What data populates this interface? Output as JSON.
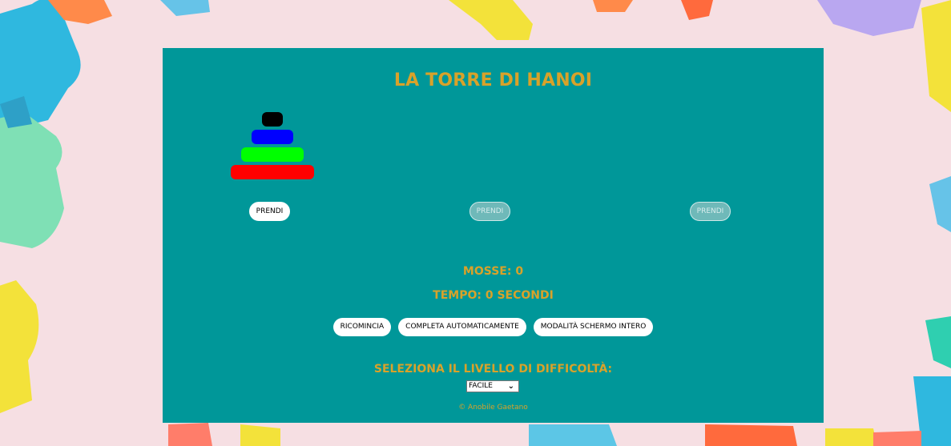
{
  "title": "LA TORRE DI HANOI",
  "towers": [
    {
      "take_label": "PRENDI",
      "enabled": true,
      "disks": [
        {
          "color": "#000000",
          "size": 1
        },
        {
          "color": "#0000ff",
          "size": 2
        },
        {
          "color": "#00ff00",
          "size": 3
        },
        {
          "color": "#ff0000",
          "size": 4
        }
      ]
    },
    {
      "take_label": "PRENDI",
      "enabled": false,
      "disks": []
    },
    {
      "take_label": "PRENDI",
      "enabled": false,
      "disks": []
    }
  ],
  "stats": {
    "moves_text": "MOSSE: 0",
    "time_text": "TEMPO: 0 SECONDI"
  },
  "actions": {
    "restart": "RICOMINCIA",
    "auto_complete": "COMPLETA AUTOMATICAMENTE",
    "fullscreen": "MODALITÀ SCHERMO INTERO"
  },
  "difficulty": {
    "label": "SELEZIONA IL LIVELLO DI DIFFICOLTÀ:",
    "selected": "FACILE"
  },
  "footer": "© Anobile Gaetano",
  "colors": {
    "panel": "#009799",
    "accent": "#d8a22a",
    "background": "#f6dfe3"
  }
}
